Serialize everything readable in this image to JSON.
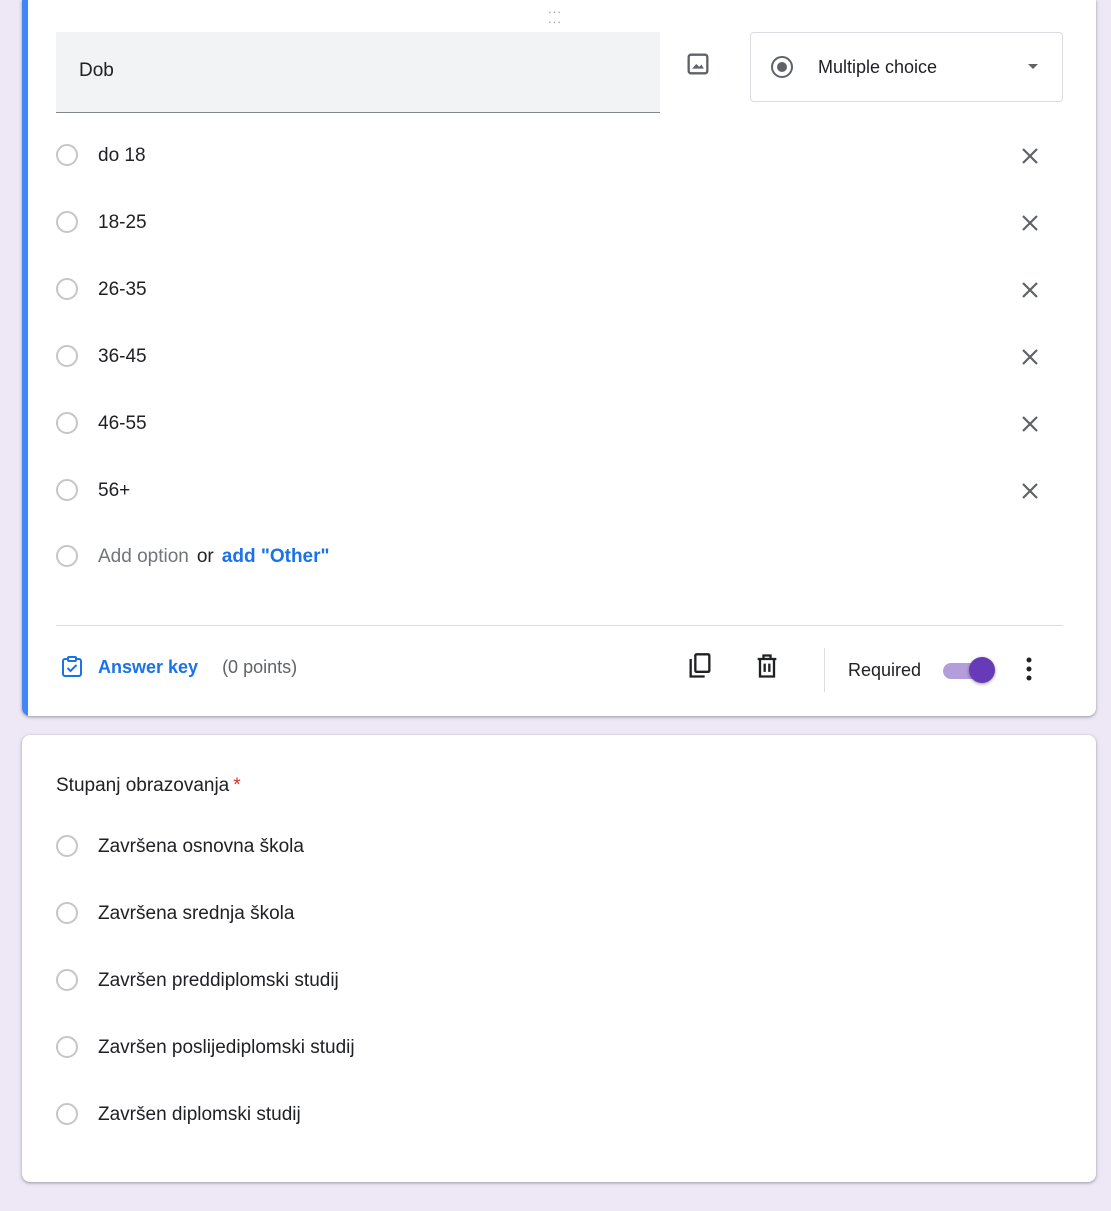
{
  "question1": {
    "title": "Dob",
    "type_label": "Multiple choice",
    "options": [
      "do 18",
      "18-25",
      "26-35",
      "36-45",
      "46-55",
      "56+"
    ],
    "add_option_label": "Add option",
    "or_label": "or",
    "add_other_label": "add \"Other\"",
    "answer_key_label": "Answer key",
    "points_label": "(0 points)",
    "required_label": "Required",
    "required_on": true
  },
  "question2": {
    "title": "Stupanj obrazovanja",
    "required_mark": "*",
    "options": [
      "Završena osnovna škola",
      "Završena srednja škola",
      "Završen preddiplomski studij",
      "Završen poslijediplomski studij",
      "Završen diplomski studij"
    ]
  },
  "colors": {
    "accent": "#4285f4",
    "link": "#1a73e8",
    "toggle": "#673ab7",
    "background": "#ede7f6",
    "required_star": "#d93025"
  },
  "icons": [
    "drag-handle-icon",
    "image-icon",
    "radio-button-icon",
    "dropdown-caret-icon",
    "close-icon",
    "answer-key-icon",
    "duplicate-icon",
    "delete-icon",
    "more-vert-icon"
  ]
}
